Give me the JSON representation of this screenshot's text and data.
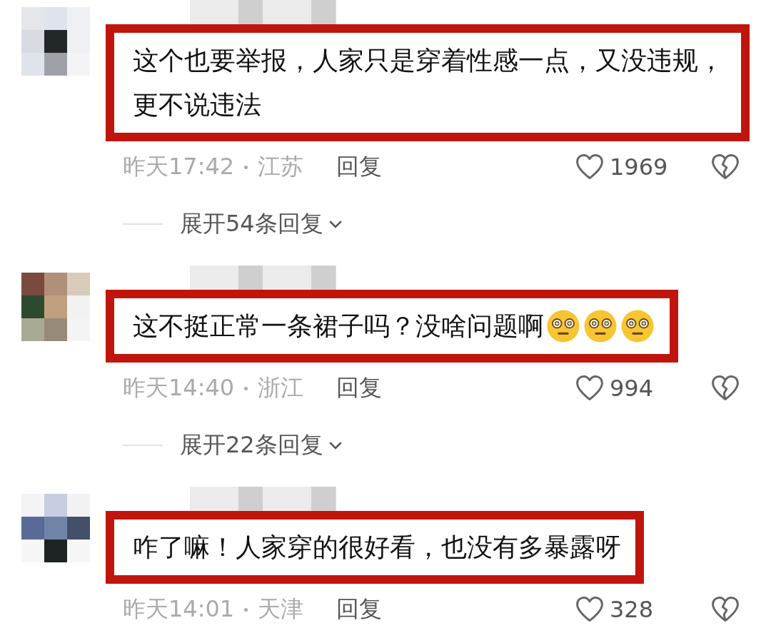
{
  "comments": [
    {
      "text": "这个也要举报，人家只是穿着性感一点，又没违规，更不说违法",
      "time": "昨天17:42",
      "location": "江苏",
      "reply": "回复",
      "likes": "1969",
      "expand": "展开54条回复"
    },
    {
      "text": "这不挺正常一条裙子吗？没啥问题啊",
      "emojis": [
        {
          "kind": "dizzy"
        },
        {
          "kind": "dizzy"
        },
        {
          "kind": "dizzy"
        }
      ],
      "time": "昨天14:40",
      "location": "浙江",
      "reply": "回复",
      "likes": "994",
      "expand": "展开22条回复"
    },
    {
      "text": "咋了嘛！人家穿的很好看，也没有多暴露呀",
      "time": "昨天14:01",
      "location": "天津",
      "reply": "回复",
      "likes": "328"
    }
  ]
}
